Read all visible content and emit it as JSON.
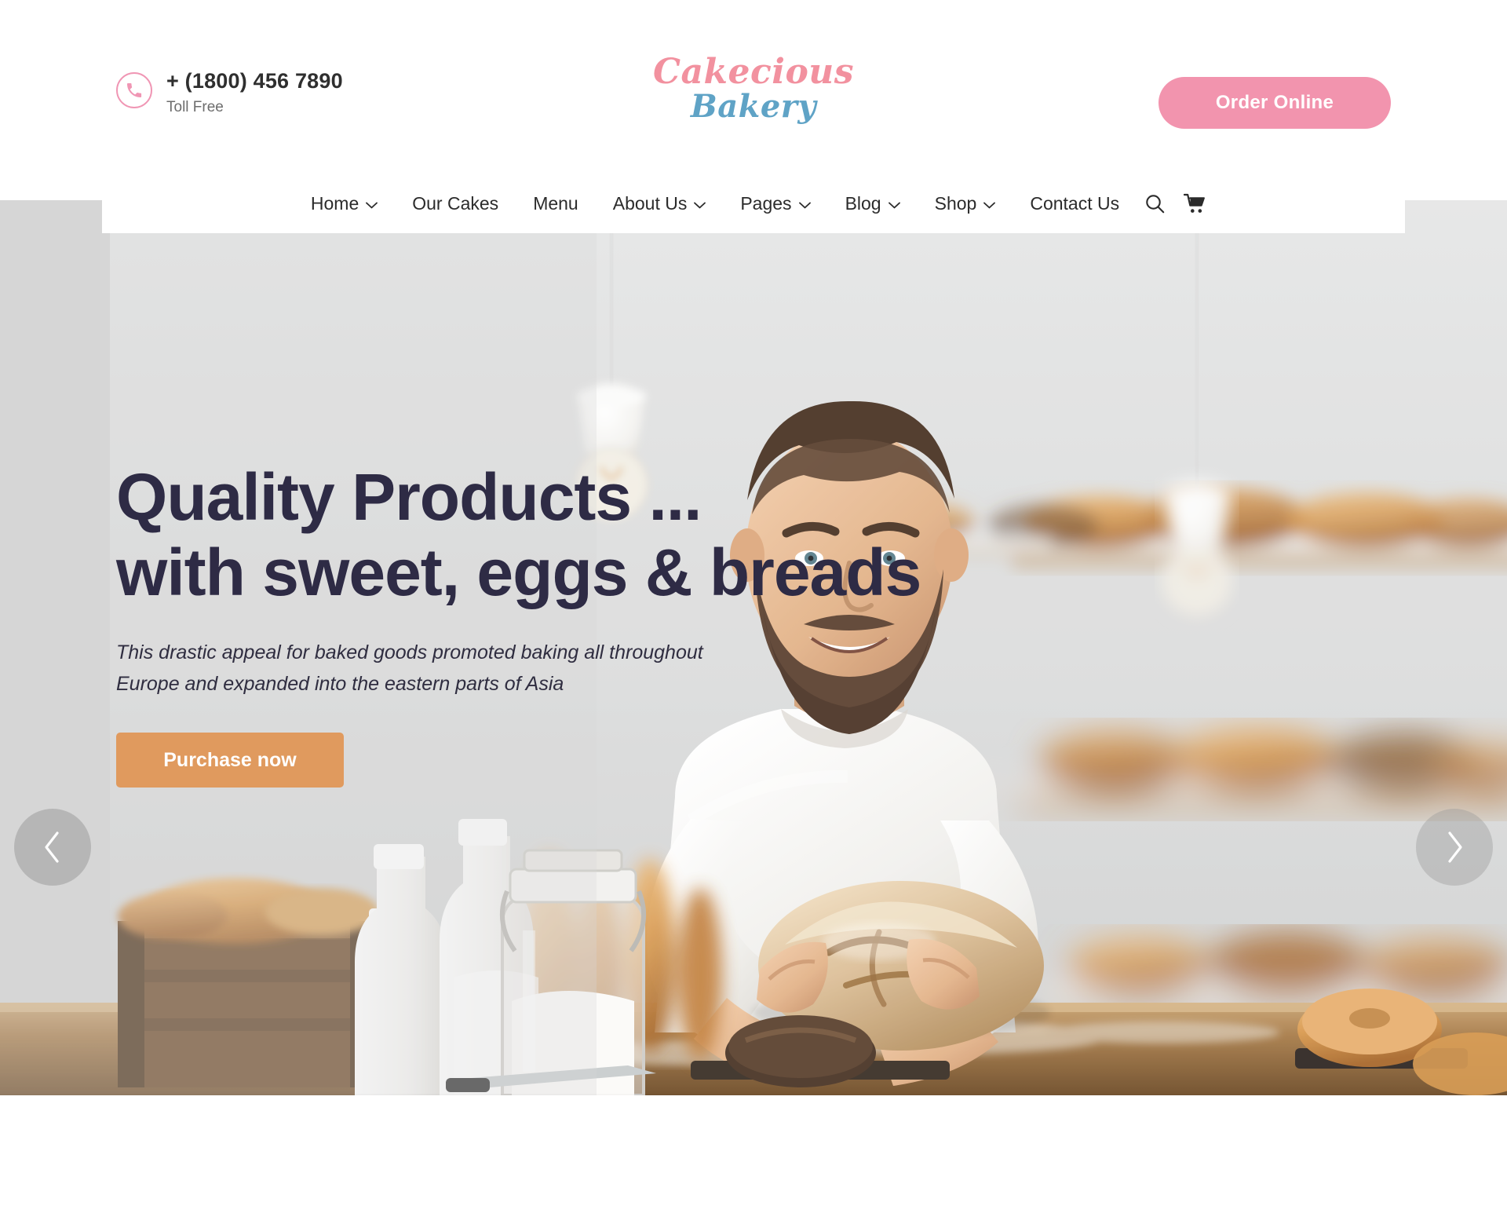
{
  "header": {
    "phone": {
      "icon": "phone-icon",
      "number": "+ (1800) 456 7890",
      "label": "Toll Free"
    },
    "logo": {
      "line1": "Cakecious",
      "line2": "Bakery",
      "color1": "#f2919f",
      "color2": "#5fa3c6"
    },
    "order_button": {
      "label": "Order Online",
      "color": "#f294ae"
    }
  },
  "nav": {
    "items": [
      {
        "label": "Home",
        "has_dropdown": true
      },
      {
        "label": "Our Cakes",
        "has_dropdown": false
      },
      {
        "label": "Menu",
        "has_dropdown": false
      },
      {
        "label": "About Us",
        "has_dropdown": true
      },
      {
        "label": "Pages",
        "has_dropdown": true
      },
      {
        "label": "Blog",
        "has_dropdown": true
      },
      {
        "label": "Shop",
        "has_dropdown": true
      },
      {
        "label": "Contact Us",
        "has_dropdown": false
      }
    ],
    "icons": [
      {
        "name": "search-icon"
      },
      {
        "name": "cart-icon"
      }
    ]
  },
  "hero": {
    "heading_line1": "Quality Products ...",
    "heading_line2": "with sweet, eggs & breads",
    "heading_color": "#2e2b45",
    "subtitle_line1": "This drastic appeal for baked goods promoted baking all throughout",
    "subtitle_line2": "Europe and expanded into the eastern parts of Asia",
    "cta": {
      "label": "Purchase now",
      "color": "#e09a5e"
    },
    "prev_arrow": "chevron-left-icon",
    "next_arrow": "chevron-right-icon",
    "scene_alt": "Smiling bearded baker in white t-shirt holding a round floured loaf of bread on a wooden counter with milk bottles, a flour jar, a wooden crate and bakery shelves behind"
  }
}
